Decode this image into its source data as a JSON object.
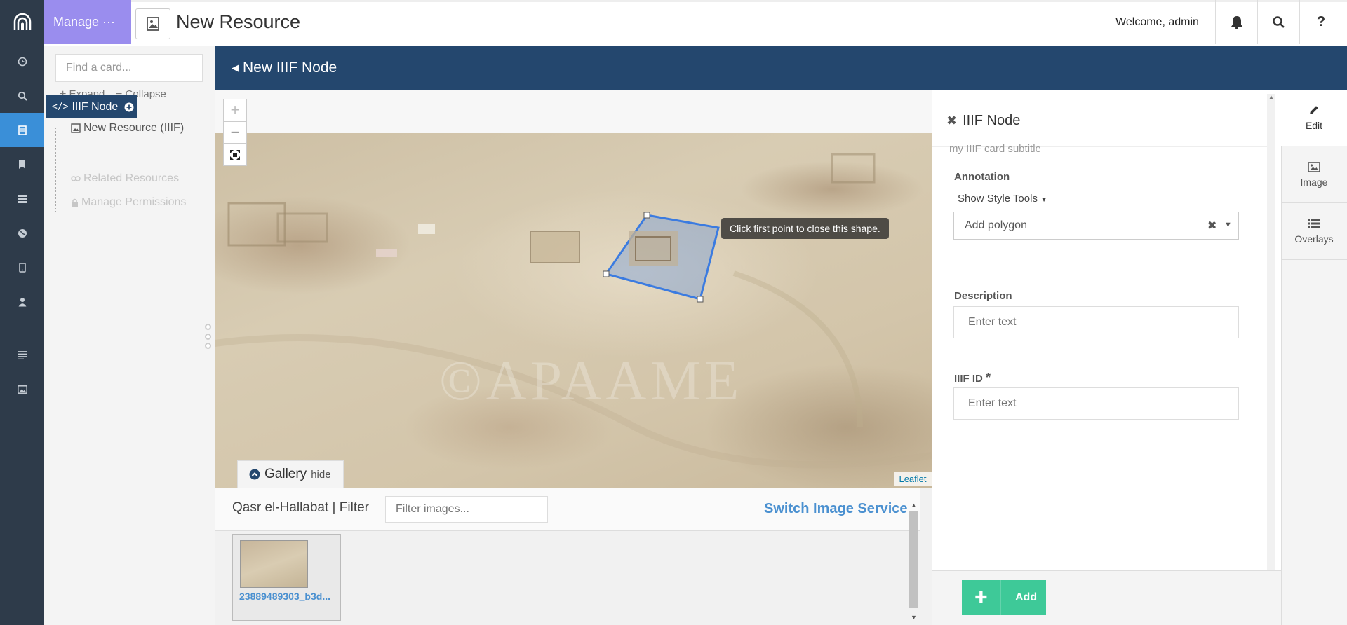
{
  "topbar": {
    "manage_label": "Manage ···",
    "title": "New Resource",
    "welcome": "Welcome, admin",
    "help": "?"
  },
  "leftnav": {
    "items": [
      "clock-icon",
      "search-icon",
      "resource-icon",
      "bookmark-icon",
      "list-icon",
      "globe-icon",
      "mobile-icon",
      "user-icon",
      "menu-icon",
      "image-icon"
    ],
    "active_index": 2
  },
  "tree": {
    "search_placeholder": "Find a card...",
    "expand": "Expand",
    "collapse": "Collapse",
    "root": "New Resource (IIIF)",
    "selected": "IIIF Node",
    "related": "Related Resources",
    "permissions": "Manage Permissions"
  },
  "main": {
    "header": "New IIIF Node"
  },
  "map": {
    "zoom_in": "+",
    "zoom_out": "−",
    "tooltip": "Click first point to close this shape.",
    "attribution": "Leaflet",
    "gallery_tab": "Gallery",
    "gallery_hide": "hide"
  },
  "gallery": {
    "title": "Qasr el-Hallabat | Filter",
    "filter_placeholder": "Filter images...",
    "switch_label": "Switch Image Service",
    "thumb_name": "23889489303_b3d..."
  },
  "card": {
    "title": "IIIF Node",
    "subtitle": "my IIIF card subtitle",
    "annotation_label": "Annotation",
    "style_tools": "Show Style Tools",
    "polygon_select": "Add polygon",
    "description_label": "Description",
    "description_placeholder": "Enter text",
    "iiif_id_label": "IIIF ID",
    "iiif_id_placeholder": "Enter text",
    "add_label": "Add"
  },
  "righttabs": {
    "edit": "Edit",
    "image": "Image",
    "overlays": "Overlays"
  },
  "colors": {
    "nav_bg": "#2e3b4a",
    "manage_bg": "#9a8dee",
    "header_bg": "#24476e",
    "active_nav": "#3a8fd8",
    "add_button": "#3ec998",
    "link": "#4a90d0"
  }
}
